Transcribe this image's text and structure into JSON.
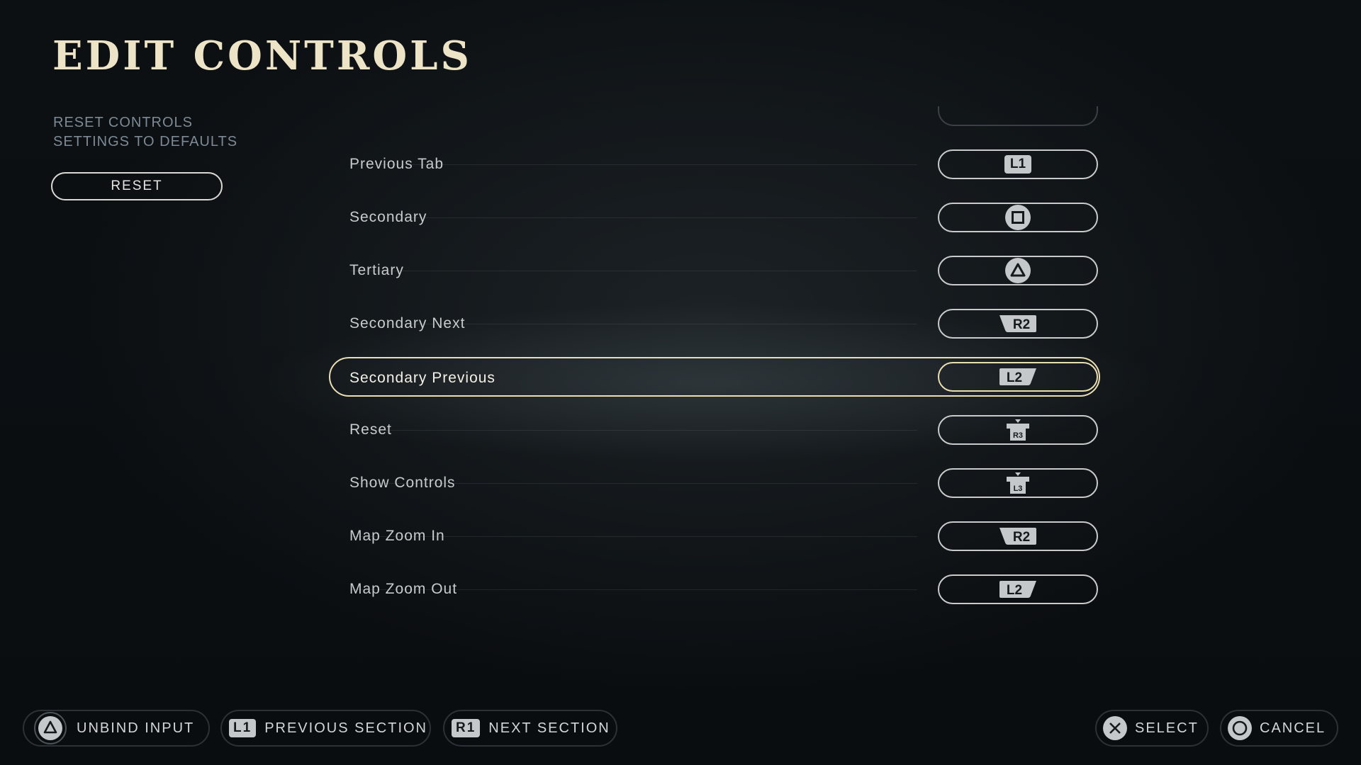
{
  "title": "EDIT CONTROLS",
  "reset_panel": {
    "description": "RESET CONTROLS\nSETTINGS TO DEFAULTS",
    "button_label": "RESET"
  },
  "controls": [
    {
      "action": "Previous Tab",
      "binding": "L1",
      "icon": "l1-button-icon"
    },
    {
      "action": "Secondary",
      "binding": "square",
      "icon": "square-button-icon"
    },
    {
      "action": "Tertiary",
      "binding": "triangle",
      "icon": "triangle-button-icon"
    },
    {
      "action": "Secondary Next",
      "binding": "R2",
      "icon": "r2-trigger-icon"
    },
    {
      "action": "Secondary Previous",
      "binding": "L2",
      "icon": "l2-trigger-icon",
      "selected": true
    },
    {
      "action": "Reset",
      "binding": "R3",
      "icon": "r3-stick-icon"
    },
    {
      "action": "Show Controls",
      "binding": "L3",
      "icon": "l3-stick-icon"
    },
    {
      "action": "Map Zoom In",
      "binding": "R2",
      "icon": "r2-trigger-icon"
    },
    {
      "action": "Map Zoom Out",
      "binding": "L2",
      "icon": "l2-trigger-icon"
    }
  ],
  "footer": {
    "unbind": {
      "label": "UNBIND INPUT",
      "icon": "triangle-button-icon"
    },
    "prev_section": {
      "label": "PREVIOUS SECTION",
      "badge": "L1"
    },
    "next_section": {
      "label": "NEXT SECTION",
      "badge": "R1"
    },
    "select": {
      "label": "SELECT",
      "icon": "cross-button-icon"
    },
    "cancel": {
      "label": "CANCEL",
      "icon": "circle-button-icon"
    }
  },
  "colors": {
    "accent": "#eadfb2",
    "title": "#ede3c6",
    "muted": "#7d8a95"
  }
}
